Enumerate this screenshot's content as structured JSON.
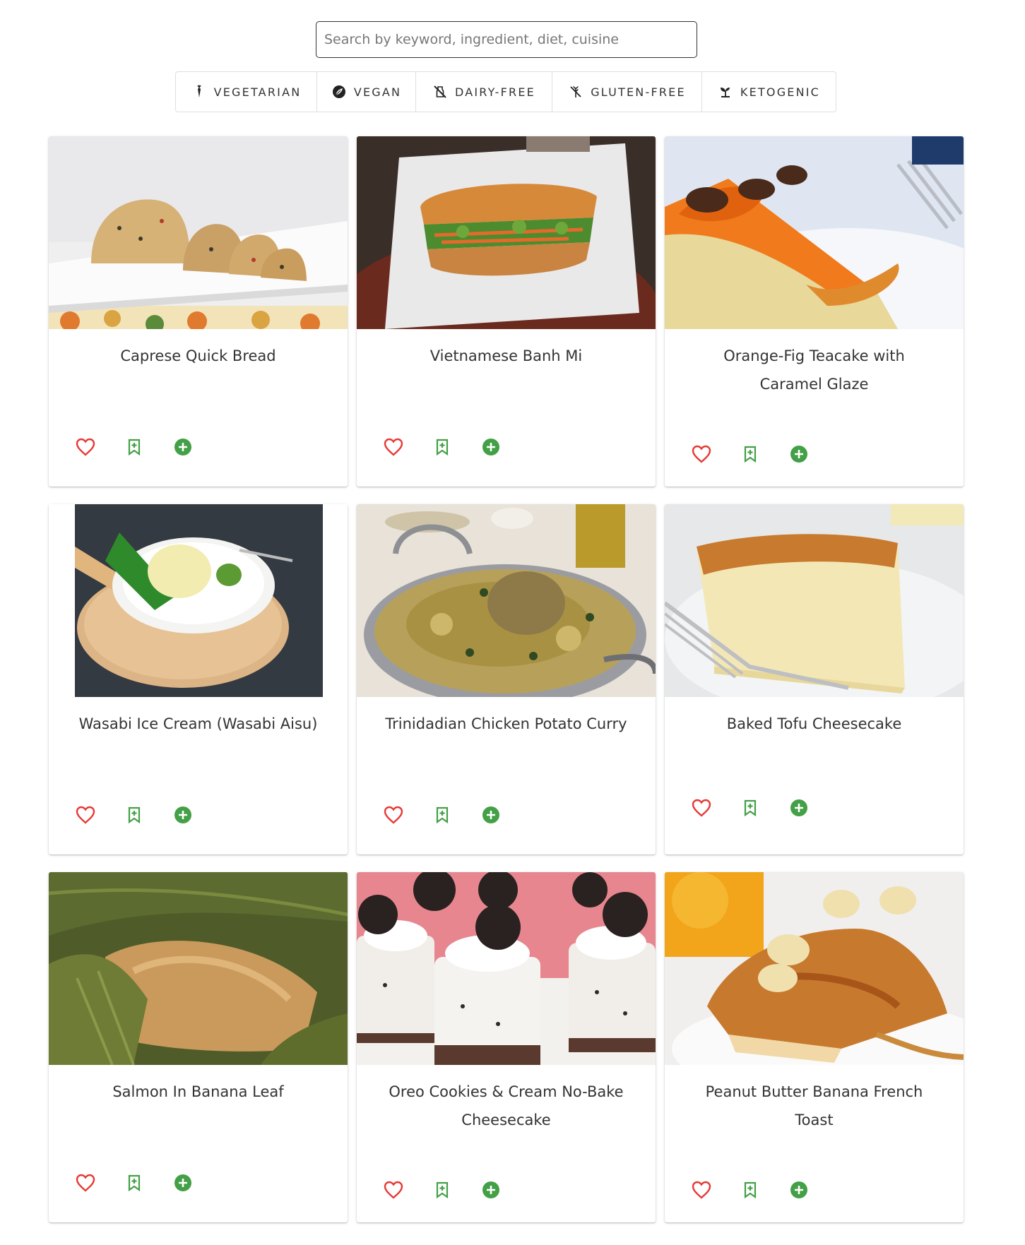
{
  "search": {
    "placeholder": "Search by keyword, ingredient, diet, cuisine"
  },
  "diets": [
    {
      "label": "VEGETARIAN",
      "icon": "carrot-icon"
    },
    {
      "label": "VEGAN",
      "icon": "leaf-icon"
    },
    {
      "label": "DAIRY-FREE",
      "icon": "no-dairy-icon"
    },
    {
      "label": "GLUTEN-FREE",
      "icon": "no-gluten-icon"
    },
    {
      "label": "KETOGENIC",
      "icon": "sprout-icon"
    }
  ],
  "colors": {
    "heart": "#e53935",
    "bookmark": "#43a047",
    "add": "#43a047"
  },
  "actions": {
    "favorite": "heart-outline-icon",
    "save": "bookmark-plus-icon",
    "add": "plus-circle-icon"
  },
  "recipes": [
    {
      "title": "Caprese Quick Bread"
    },
    {
      "title": "Vietnamese Banh Mi"
    },
    {
      "title": "Orange-Fig Teacake with Caramel Glaze"
    },
    {
      "title": "Wasabi Ice Cream (Wasabi Aisu)"
    },
    {
      "title": "Trinidadian Chicken Potato Curry"
    },
    {
      "title": "Baked Tofu Cheesecake"
    },
    {
      "title": "Salmon In Banana Leaf"
    },
    {
      "title": "Oreo Cookies & Cream No-Bake Cheesecake"
    },
    {
      "title": "Peanut Butter Banana French Toast"
    }
  ]
}
